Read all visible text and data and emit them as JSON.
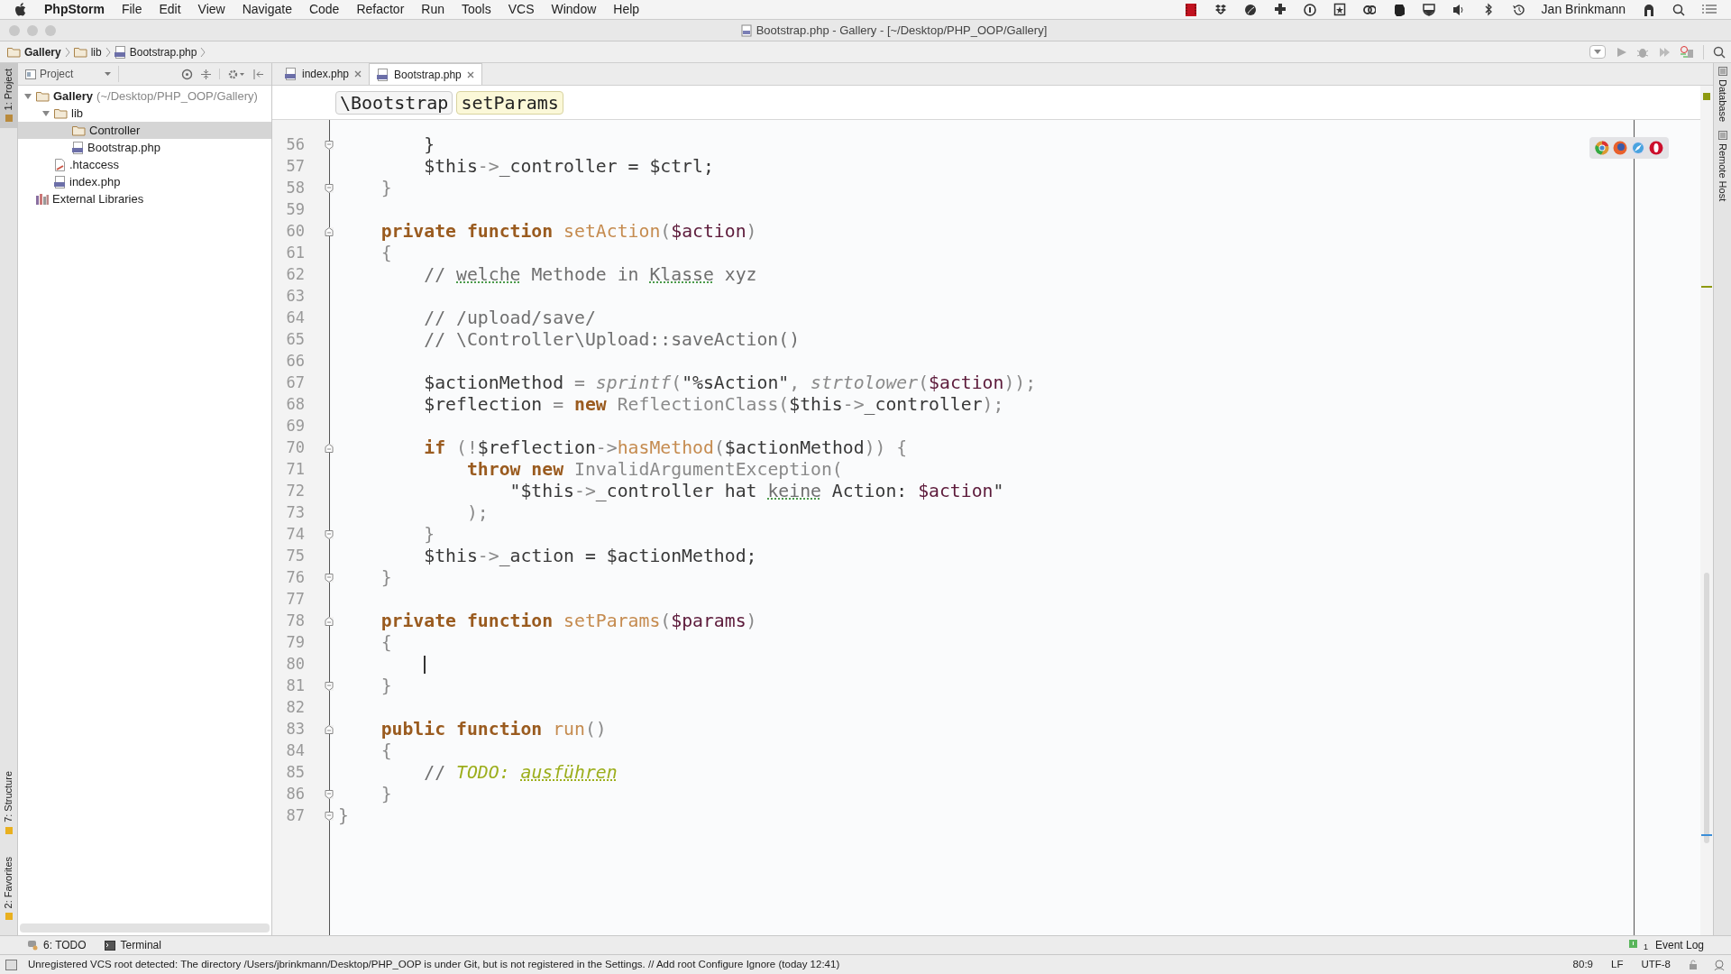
{
  "menubar": {
    "app": "PhpStorm",
    "menus": [
      "File",
      "Edit",
      "View",
      "Navigate",
      "Code",
      "Refactor",
      "Run",
      "Tools",
      "VCS",
      "Window",
      "Help"
    ],
    "user": "Jan Brinkmann"
  },
  "window": {
    "title": "Bootstrap.php - Gallery - [~/Desktop/PHP_OOP/Gallery]"
  },
  "navbar": {
    "crumbs": [
      {
        "label": "Gallery",
        "kind": "folder"
      },
      {
        "label": "lib",
        "kind": "folder"
      },
      {
        "label": "Bootstrap.php",
        "kind": "php"
      }
    ]
  },
  "left_stripe": [
    {
      "label": "1: Project",
      "selected": true,
      "kind": "top"
    },
    {
      "label": "7: Structure",
      "selected": false,
      "kind": "bottom"
    },
    {
      "label": "2: Favorites",
      "selected": false,
      "kind": "bottom"
    }
  ],
  "project": {
    "view": "Project",
    "tree": [
      {
        "label": "Gallery",
        "detail": "(~/Desktop/PHP_OOP/Gallery)",
        "kind": "folder",
        "expanded": true,
        "selected": false,
        "children": [
          {
            "label": "lib",
            "kind": "folder",
            "expanded": true,
            "selected": false,
            "children": [
              {
                "label": "Controller",
                "kind": "folder",
                "selected": true
              },
              {
                "label": "Bootstrap.php",
                "kind": "php",
                "selected": false
              }
            ]
          },
          {
            "label": ".htaccess",
            "kind": "config",
            "selected": false
          },
          {
            "label": "index.php",
            "kind": "php",
            "selected": false
          }
        ]
      },
      {
        "label": "External Libraries",
        "kind": "library",
        "selected": false
      }
    ]
  },
  "tabs": [
    {
      "label": "index.php",
      "selected": false
    },
    {
      "label": "Bootstrap.php",
      "selected": true
    }
  ],
  "editor_breadcrumb": [
    {
      "label": "\\Bootstrap",
      "selected": false
    },
    {
      "label": "setParams",
      "selected": true
    }
  ],
  "code": [
    {
      "number": "56",
      "fold_start": false,
      "fold_end": true,
      "caret": false,
      "tokens": [
        {
          "text": "        }",
          "kind": "plain"
        }
      ]
    },
    {
      "number": "57",
      "fold_start": false,
      "fold_end": false,
      "caret": false,
      "tokens": [
        {
          "text": "        $this",
          "kind": "plain"
        },
        {
          "text": "->",
          "kind": "op"
        },
        {
          "text": "_controller = $ctrl;",
          "kind": "plain"
        }
      ]
    },
    {
      "number": "58",
      "fold_start": false,
      "fold_end": true,
      "caret": false,
      "tokens": [
        {
          "text": "    }",
          "kind": "op"
        }
      ]
    },
    {
      "number": "59",
      "fold_start": false,
      "fold_end": false,
      "caret": false
    },
    {
      "number": "60",
      "fold_start": true,
      "fold_end": false,
      "caret": false,
      "tokens": [
        {
          "text": "    private function ",
          "kind": "keyword"
        },
        {
          "text": "setAction",
          "kind": "decl"
        },
        {
          "text": "(",
          "kind": "op"
        },
        {
          "text": "$action",
          "kind": "var"
        },
        {
          "text": ")",
          "kind": "op"
        }
      ]
    },
    {
      "number": "61",
      "fold_start": false,
      "fold_end": false,
      "caret": false,
      "tokens": [
        {
          "text": "    {",
          "kind": "op"
        }
      ]
    },
    {
      "number": "62",
      "fold_start": false,
      "fold_end": false,
      "caret": false,
      "tokens": [
        {
          "text": "        // ",
          "kind": "comment"
        },
        {
          "text": "welche",
          "kind": "typo"
        },
        {
          "text": " Methode in ",
          "kind": "comment"
        },
        {
          "text": "Klasse",
          "kind": "typo"
        },
        {
          "text": " xyz",
          "kind": "comment"
        }
      ]
    },
    {
      "number": "63",
      "fold_start": false,
      "fold_end": false,
      "caret": false
    },
    {
      "number": "64",
      "fold_start": false,
      "fold_end": false,
      "caret": false,
      "tokens": [
        {
          "text": "        // /upload/save/",
          "kind": "comment"
        }
      ]
    },
    {
      "number": "65",
      "fold_start": false,
      "fold_end": false,
      "caret": false,
      "tokens": [
        {
          "text": "        // \\Controller\\Upload::saveAction()",
          "kind": "comment"
        }
      ]
    },
    {
      "number": "66",
      "fold_start": false,
      "fold_end": false,
      "caret": false
    },
    {
      "number": "67",
      "fold_start": false,
      "fold_end": false,
      "caret": false,
      "tokens": [
        {
          "text": "        $actionMethod",
          "kind": "plain"
        },
        {
          "text": " = ",
          "kind": "op"
        },
        {
          "text": "sprintf",
          "kind": "call"
        },
        {
          "text": "(",
          "kind": "op"
        },
        {
          "text": "\"%sAction\"",
          "kind": "plain"
        },
        {
          "text": ", ",
          "kind": "op"
        },
        {
          "text": "strtolower",
          "kind": "call"
        },
        {
          "text": "(",
          "kind": "op"
        },
        {
          "text": "$action",
          "kind": "var"
        },
        {
          "text": "));",
          "kind": "op"
        }
      ]
    },
    {
      "number": "68",
      "fold_start": false,
      "fold_end": false,
      "caret": false,
      "tokens": [
        {
          "text": "        $reflection",
          "kind": "plain"
        },
        {
          "text": " = ",
          "kind": "op"
        },
        {
          "text": "new ",
          "kind": "keyword"
        },
        {
          "text": "ReflectionClass(",
          "kind": "op"
        },
        {
          "text": "$this",
          "kind": "plain"
        },
        {
          "text": "->",
          "kind": "op"
        },
        {
          "text": "_controller",
          "kind": "plain"
        },
        {
          "text": ");",
          "kind": "op"
        }
      ]
    },
    {
      "number": "69",
      "fold_start": false,
      "fold_end": false,
      "caret": false
    },
    {
      "number": "70",
      "fold_start": true,
      "fold_end": false,
      "caret": false,
      "tokens": [
        {
          "text": "        if ",
          "kind": "keyword"
        },
        {
          "text": "(!",
          "kind": "op"
        },
        {
          "text": "$reflection",
          "kind": "plain"
        },
        {
          "text": "->",
          "kind": "op"
        },
        {
          "text": "hasMethod",
          "kind": "decl"
        },
        {
          "text": "(",
          "kind": "op"
        },
        {
          "text": "$actionMethod",
          "kind": "plain"
        },
        {
          "text": ")) {",
          "kind": "op"
        }
      ]
    },
    {
      "number": "71",
      "fold_start": false,
      "fold_end": false,
      "caret": false,
      "tokens": [
        {
          "text": "            throw new ",
          "kind": "keyword"
        },
        {
          "text": "InvalidArgumentException(",
          "kind": "op"
        }
      ]
    },
    {
      "number": "72",
      "fold_start": false,
      "fold_end": false,
      "caret": false,
      "tokens": [
        {
          "text": "                \"$this",
          "kind": "plain"
        },
        {
          "text": "->",
          "kind": "op"
        },
        {
          "text": "_controller hat ",
          "kind": "plain"
        },
        {
          "text": "keine",
          "kind": "typo"
        },
        {
          "text": " Action: ",
          "kind": "plain"
        },
        {
          "text": "$action",
          "kind": "var"
        },
        {
          "text": "\"",
          "kind": "plain"
        }
      ]
    },
    {
      "number": "73",
      "fold_start": false,
      "fold_end": false,
      "caret": false,
      "tokens": [
        {
          "text": "            );",
          "kind": "op"
        }
      ]
    },
    {
      "number": "74",
      "fold_start": false,
      "fold_end": true,
      "caret": false,
      "tokens": [
        {
          "text": "        }",
          "kind": "op"
        }
      ]
    },
    {
      "number": "75",
      "fold_start": false,
      "fold_end": false,
      "caret": false,
      "tokens": [
        {
          "text": "        $this",
          "kind": "plain"
        },
        {
          "text": "->",
          "kind": "op"
        },
        {
          "text": "_action = $actionMethod;",
          "kind": "plain"
        }
      ]
    },
    {
      "number": "76",
      "fold_start": false,
      "fold_end": true,
      "caret": false,
      "tokens": [
        {
          "text": "    }",
          "kind": "op"
        }
      ]
    },
    {
      "number": "77",
      "fold_start": false,
      "fold_end": false,
      "caret": false
    },
    {
      "number": "78",
      "fold_start": true,
      "fold_end": false,
      "caret": false,
      "tokens": [
        {
          "text": "    private function ",
          "kind": "keyword"
        },
        {
          "text": "setParams",
          "kind": "decl"
        },
        {
          "text": "(",
          "kind": "op"
        },
        {
          "text": "$params",
          "kind": "var"
        },
        {
          "text": ")",
          "kind": "op"
        }
      ]
    },
    {
      "number": "79",
      "fold_start": false,
      "fold_end": false,
      "caret": false,
      "tokens": [
        {
          "text": "    {",
          "kind": "op"
        }
      ]
    },
    {
      "number": "80",
      "fold_start": false,
      "fold_end": false,
      "caret": true
    },
    {
      "number": "81",
      "fold_start": false,
      "fold_end": true,
      "caret": false,
      "tokens": [
        {
          "text": "    }",
          "kind": "op"
        }
      ]
    },
    {
      "number": "82",
      "fold_start": false,
      "fold_end": false,
      "caret": false
    },
    {
      "number": "83",
      "fold_start": true,
      "fold_end": false,
      "caret": false,
      "tokens": [
        {
          "text": "    public function ",
          "kind": "keyword"
        },
        {
          "text": "run",
          "kind": "decl"
        },
        {
          "text": "()",
          "kind": "op"
        }
      ]
    },
    {
      "number": "84",
      "fold_start": false,
      "fold_end": false,
      "caret": false,
      "tokens": [
        {
          "text": "    {",
          "kind": "op"
        }
      ]
    },
    {
      "number": "85",
      "fold_start": false,
      "fold_end": false,
      "caret": false,
      "tokens": [
        {
          "text": "        // ",
          "kind": "comment"
        },
        {
          "text": "TODO: ",
          "kind": "todo"
        },
        {
          "text": "ausführen",
          "kind": "todo-typo"
        }
      ]
    },
    {
      "number": "86",
      "fold_start": false,
      "fold_end": true,
      "caret": false,
      "tokens": [
        {
          "text": "    }",
          "kind": "op"
        }
      ]
    },
    {
      "number": "87",
      "fold_start": false,
      "fold_end": true,
      "caret": false,
      "tokens": [
        {
          "text": "}",
          "kind": "op"
        }
      ]
    }
  ],
  "right_stripe": [
    "Database",
    "Remote Host"
  ],
  "tool_windows": [
    {
      "label": "6: TODO",
      "kind": "todo"
    },
    {
      "label": "Terminal",
      "kind": "terminal"
    }
  ],
  "event_log": {
    "label": "Event Log",
    "count": "1"
  },
  "status_bar": {
    "message": "Unregistered VCS root detected: The directory /Users/jbrinkmann/Desktop/PHP_OOP is under Git, but is not registered in the Settings. // Add root  Configure  Ignore (today 12:41)",
    "position": "80:9",
    "line_separator": "LF",
    "encoding": "UTF-8"
  }
}
